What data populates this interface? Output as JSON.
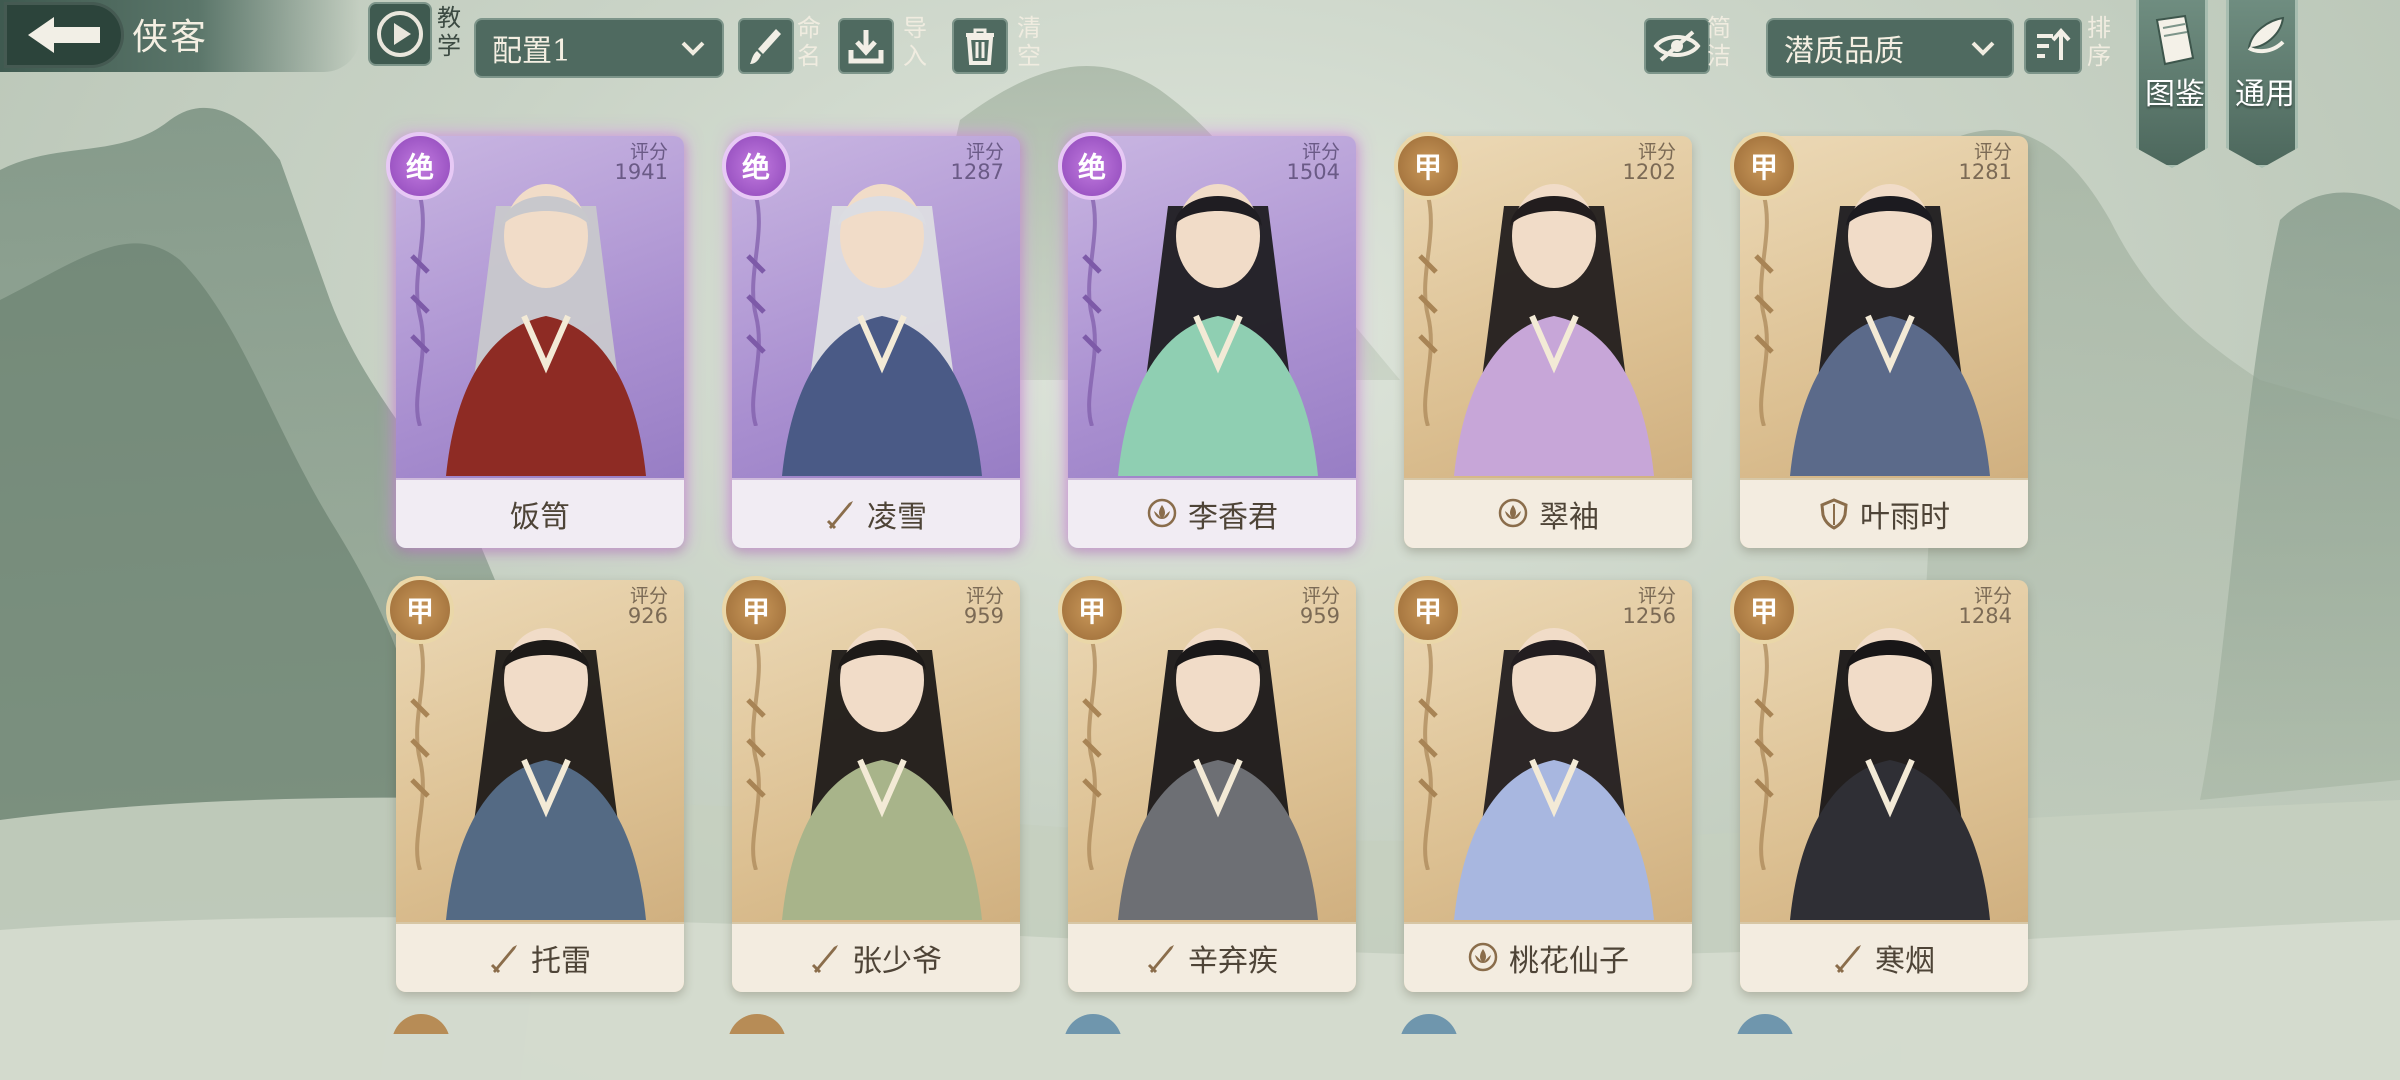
{
  "header": {
    "title": "侠客",
    "tutorial_label": "教学",
    "config_select": "配置1",
    "rename_label": "命名",
    "import_label": "导入",
    "clear_label": "清空",
    "compact_label": "简洁",
    "sort_select": "潜质品质",
    "sort_label": "排序",
    "codex_label": "图鉴",
    "general_label": "通用"
  },
  "score_label": "评分",
  "cards": [
    {
      "name": "饭笥",
      "score": "1941",
      "rank": "绝",
      "tier": "purple",
      "class_icon": "none",
      "hair": "#c8c8cc",
      "outfit": "#8e2b24"
    },
    {
      "name": "凌雪",
      "score": "1287",
      "rank": "绝",
      "tier": "purple",
      "class_icon": "sword-icon",
      "hair": "#dcdde2",
      "outfit": "#4a5a86"
    },
    {
      "name": "李香君",
      "score": "1504",
      "rank": "绝",
      "tier": "purple",
      "class_icon": "lotus-icon",
      "hair": "#1f1d22",
      "outfit": "#8fcfb2"
    },
    {
      "name": "翠袖",
      "score": "1202",
      "rank": "甲",
      "tier": "gold",
      "class_icon": "lotus-icon",
      "hair": "#221d1e",
      "outfit": "#c7a6d8"
    },
    {
      "name": "叶雨时",
      "score": "1281",
      "rank": "甲",
      "tier": "gold",
      "class_icon": "shield-icon",
      "hair": "#1c1b20",
      "outfit": "#5b6a8a"
    },
    {
      "name": "托雷",
      "score": "926",
      "rank": "甲",
      "tier": "gold",
      "class_icon": "sword-icon",
      "hair": "#1d1a18",
      "outfit": "#546a84"
    },
    {
      "name": "张少爷",
      "score": "959",
      "rank": "甲",
      "tier": "gold",
      "class_icon": "sword-icon",
      "hair": "#1d1a18",
      "outfit": "#a8b48a"
    },
    {
      "name": "辛弃疾",
      "score": "959",
      "rank": "甲",
      "tier": "gold",
      "class_icon": "sword-icon",
      "hair": "#1a1819",
      "outfit": "#6d6f74"
    },
    {
      "name": "桃花仙子",
      "score": "1256",
      "rank": "甲",
      "tier": "gold",
      "class_icon": "lotus-icon",
      "hair": "#221d20",
      "outfit": "#a8b7e0"
    },
    {
      "name": "寒烟",
      "score": "1284",
      "rank": "甲",
      "tier": "gold",
      "class_icon": "sword-icon",
      "hair": "#181617",
      "outfit": "#2f2f35"
    }
  ],
  "colors": {
    "panel": "#4f6a60",
    "purple_card": "#a98fd0",
    "gold_card": "#dcc092",
    "glow": "#dc8cf0"
  }
}
